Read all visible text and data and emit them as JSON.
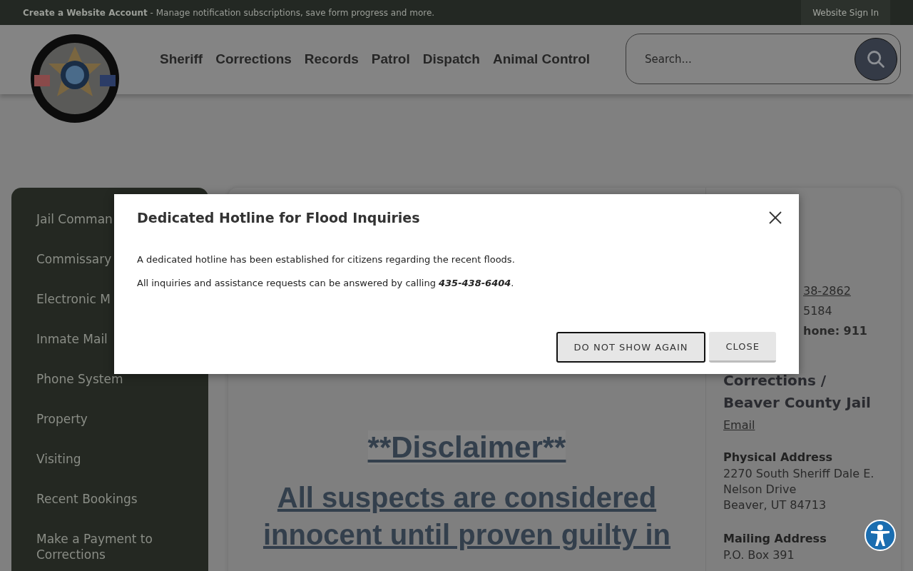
{
  "top_bar": {
    "account_text": "**Create a Website Account** - Manage notification subscriptions, save form progress and more.",
    "sign_in": "Website Sign In"
  },
  "header": {
    "nav": [
      "Sheriff",
      "Corrections",
      "Records",
      "Patrol",
      "Dispatch",
      "Animal Control"
    ],
    "search": {
      "placeholder": "Search..."
    }
  },
  "sidebar": {
    "items": [
      "Jail Comman",
      "Commissary",
      "Electronic M",
      "Inmate Mail",
      "Phone System",
      "Property",
      "Visiting",
      "Recent Bookings",
      "Make a Payment to Corrections"
    ]
  },
  "main": {
    "disclaimer_title": "**Disclaimer**",
    "disclaimer_text": "All suspects are considered innocent until proven guilty in"
  },
  "contact": {
    "phone_lines": [
      {
        "text": "38-2862",
        "kind": "link"
      },
      {
        "text": "5184",
        "kind": "plain"
      },
      {
        "text": "hone: 911",
        "kind": "bold"
      }
    ],
    "heading": "Corrections / Beaver County Jail",
    "email": "Email",
    "sections": [
      {
        "label": "Physical Address",
        "lines": [
          "2270 South Sheriff Dale E.",
          "Nelson Drive",
          "Beaver, UT 84713"
        ]
      },
      {
        "label": "Mailing Address",
        "lines": [
          "P.O. Box 391"
        ]
      }
    ]
  },
  "modal": {
    "title": "Dedicated Hotline for Flood Inquiries",
    "paragraphs": [
      "A dedicated hotline has been established for citizens regarding the recent floods.",
      "All inquiries and assistance requests can be answered by calling **435-438-6404**."
    ],
    "buttons": [
      {
        "label": "DO NOT SHOW AGAIN",
        "kind": "outlined"
      },
      {
        "label": "CLOSE",
        "kind": "plain"
      }
    ]
  }
}
